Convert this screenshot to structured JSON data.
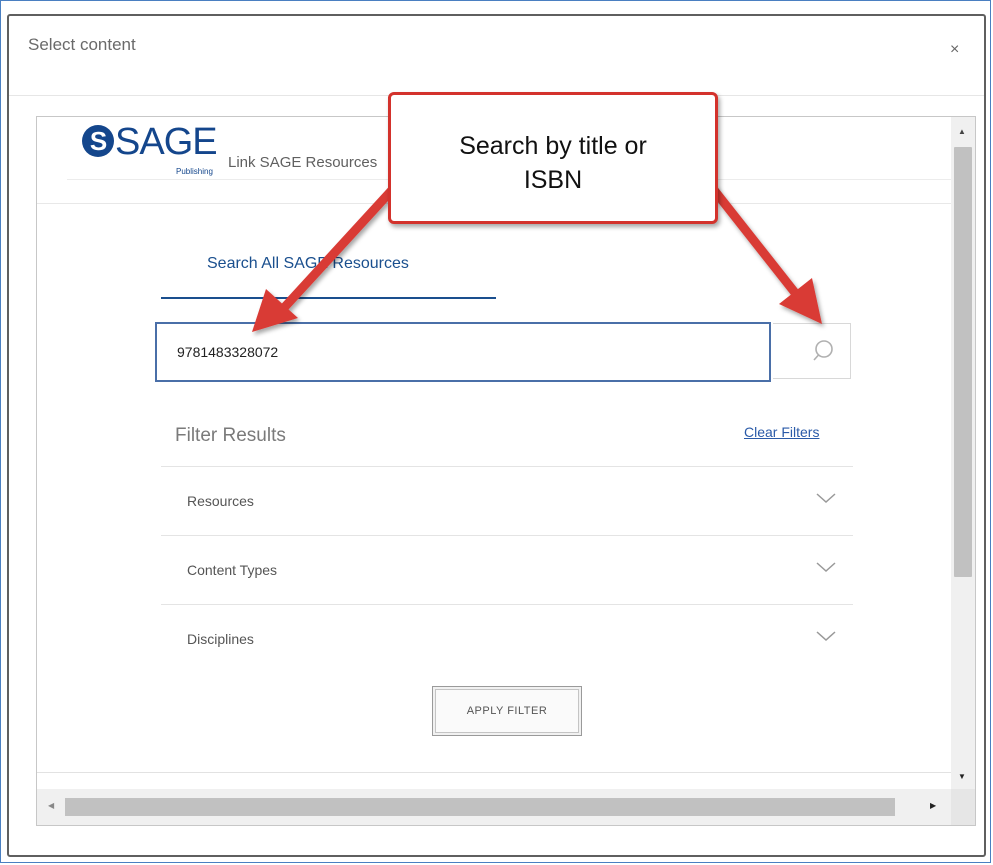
{
  "dialog": {
    "title": "Select content",
    "close_label": "×"
  },
  "brand": {
    "logo_letter": "S",
    "logo_text": "SAGE",
    "logo_sub": "Publishing",
    "link_title": "Link SAGE Resources"
  },
  "tabs": [
    {
      "label": "Search All SAGE Resources",
      "active": true
    }
  ],
  "search": {
    "value": "9781483328072",
    "icon": "search-icon"
  },
  "filters": {
    "title": "Filter Results",
    "clear_label": "Clear Filters",
    "items": [
      {
        "label": "Resources",
        "icon": "chevron-down-icon"
      },
      {
        "label": "Content Types",
        "icon": "chevron-down-icon"
      },
      {
        "label": "Disciplines",
        "icon": "chevron-down-icon"
      }
    ],
    "apply_label": "APPLY FILTER"
  },
  "annotation": {
    "line1": "Search by title or",
    "line2": "ISBN",
    "color": "#d3322c"
  },
  "colors": {
    "brand": "#14468c",
    "link": "#2a5aa8",
    "input_border": "#4a6fa8"
  }
}
